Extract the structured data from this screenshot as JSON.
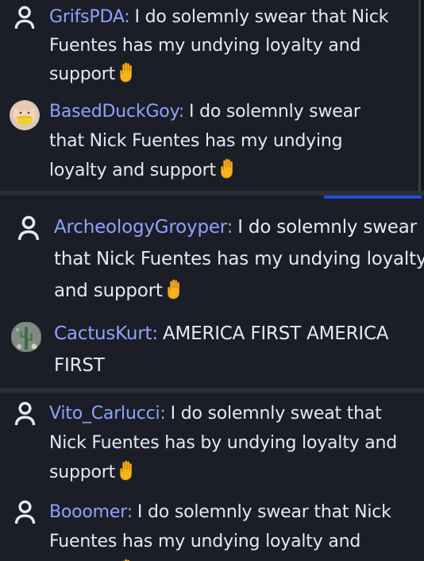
{
  "panels": [
    {
      "messages": [
        {
          "avatar": "user-outline-icon",
          "username": "GrifsPDA",
          "text": "I do solemnly swear that Nick Fuentes has my undying loyalty and support",
          "emoji": "raised-hand-icon"
        },
        {
          "avatar": "masked-face-avatar",
          "username": "BasedDuckGoy",
          "text": "I do solemnly swear that Nick Fuentes has my undying loyalty and support",
          "emoji": "raised-hand-icon"
        }
      ]
    },
    {
      "messages": [
        {
          "avatar": "user-outline-icon",
          "username": "ArcheologyGroyper",
          "text": "I do solemnly swear that Nick Fuentes has my undying loyalty and support",
          "emoji": "raised-hand-icon"
        },
        {
          "avatar": "cactus-photo-avatar",
          "username": "CactusKurt",
          "text": "AMERICA FIRST AMERICA FIRST",
          "emoji": ""
        }
      ]
    },
    {
      "messages": [
        {
          "avatar": "user-outline-icon",
          "username": "Vito_Carlucci",
          "text": "I do solemnly sweat that Nick Fuentes has by undying loyalty and support",
          "emoji": "raised-hand-icon"
        },
        {
          "avatar": "user-outline-icon",
          "username": "Booomer",
          "text": "I do solemnly swear that Nick Fuentes has my undying loyalty and support",
          "emoji": "raised-hand-icon"
        }
      ]
    }
  ],
  "colors": {
    "background": "#1b1e27",
    "username": "#8ea3ff",
    "message_text": "#e7e9ee",
    "divider": "#2b2d32",
    "accent_bar": "#1d4fd8",
    "hand_emoji": "#f6b21b"
  }
}
